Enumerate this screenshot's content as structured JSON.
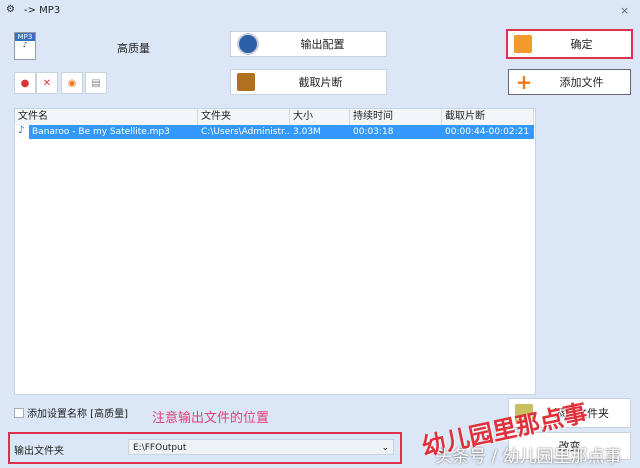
{
  "window": {
    "title": "-> MP3",
    "close": "×"
  },
  "profile": {
    "quality": "高质量"
  },
  "buttons": {
    "output_config": "输出配置",
    "clip": "截取片断",
    "ok": "确定",
    "add_file": "添加文件",
    "add_folder": "添加文件夹",
    "change": "改变"
  },
  "table": {
    "headers": [
      "文件名",
      "文件夹",
      "大小",
      "持续时间",
      "截取片断"
    ],
    "rows": [
      {
        "name": "Banaroo - Be my Satellite.mp3",
        "folder": "C:\\Users\\Administr...",
        "size": "3.03M",
        "duration": "00:03:18",
        "clip": "00:00:44-00:02:21"
      }
    ]
  },
  "options": {
    "add_setting_name": "添加设置名称 [高质量]",
    "annotation": "注意输出文件的位置"
  },
  "output": {
    "label": "输出文件夹",
    "value": "E:\\FFOutput"
  },
  "watermark": {
    "main": "幼儿园里那点事",
    "source": "头条号 / 幼儿园里那点事"
  }
}
